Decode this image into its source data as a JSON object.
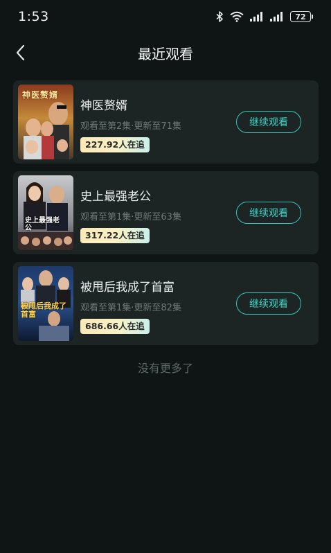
{
  "status_bar": {
    "time": "1:53",
    "battery": "72"
  },
  "nav": {
    "title": "最近观看"
  },
  "items": [
    {
      "title": "神医赘婿",
      "progress": "观看至第2集·更新至71集",
      "followers": "227.92人在追",
      "button": "继续观看",
      "poster_text": "神医赘婿"
    },
    {
      "title": "史上最强老公",
      "progress": "观看至第1集·更新至63集",
      "followers": "317.22人在追",
      "button": "继续观看",
      "poster_text": "史上最强老公"
    },
    {
      "title": "被甩后我成了首富",
      "progress": "观看至第1集·更新至82集",
      "followers": "686.66人在追",
      "button": "继续观看",
      "poster_text": "被甩后我成了首富"
    }
  ],
  "footer": {
    "no_more": "没有更多了"
  },
  "colors": {
    "background": "#0f1515",
    "card": "#1c2424",
    "accent": "#3fd6c7"
  }
}
